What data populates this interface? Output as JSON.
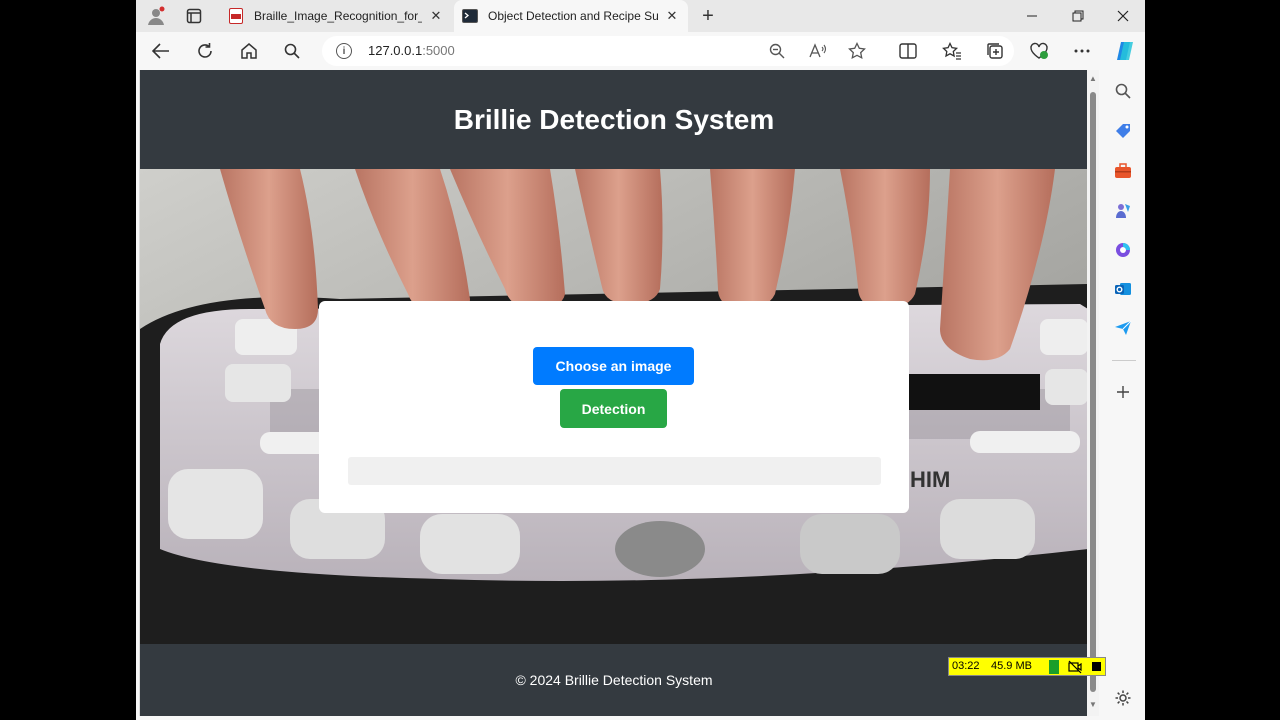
{
  "browser": {
    "tabs": [
      {
        "label": "Braille_Image_Recognition_for_Be",
        "favicon": "pdf-icon",
        "active": false
      },
      {
        "label": "Object Detection and Recipe Sug",
        "favicon": "terminal-icon",
        "active": true
      }
    ],
    "address": {
      "host": "127.0.0.1",
      "port": ":5000"
    },
    "accent": "#0078d4"
  },
  "site": {
    "title": "Brillie Detection System",
    "footer": "© 2024 Brillie Detection System",
    "buttons": {
      "choose": "Choose an image",
      "detect": "Detection"
    },
    "colors": {
      "header": "#343a40",
      "choose": "#007bff",
      "detect": "#28a745"
    }
  },
  "meter": {
    "time": "03:22",
    "memory": "45.9 MB"
  }
}
